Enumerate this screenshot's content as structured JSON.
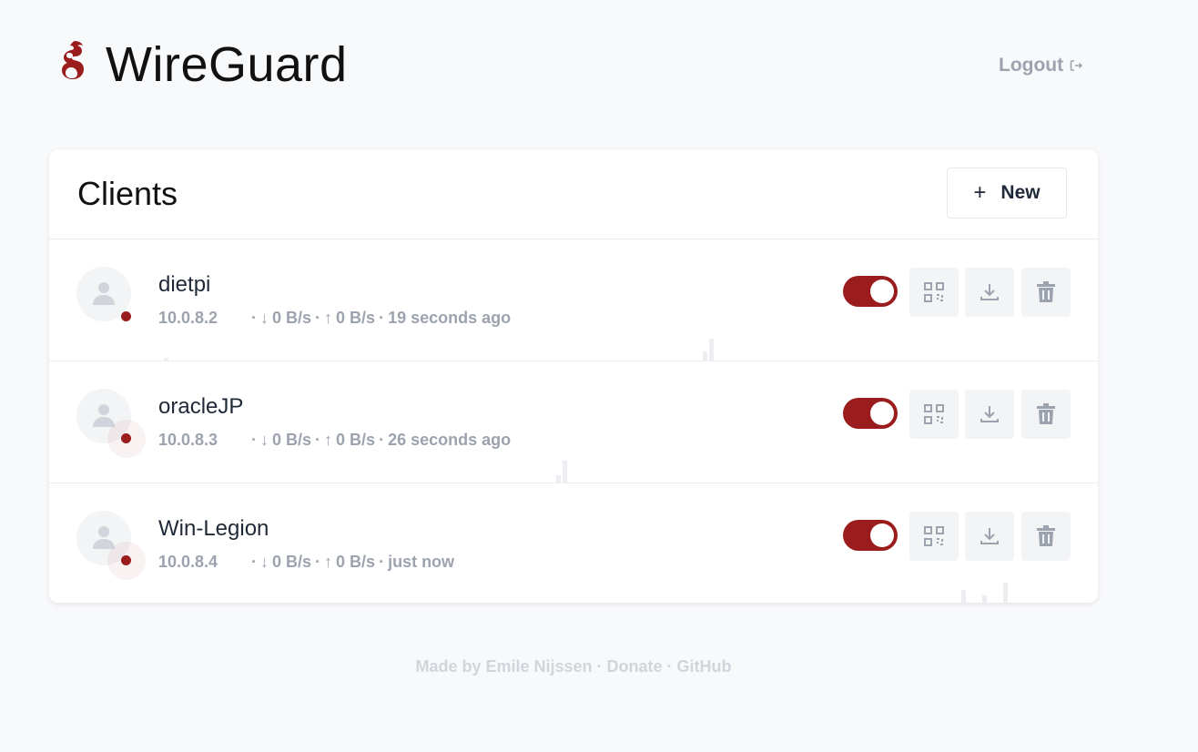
{
  "app": {
    "title": "WireGuard",
    "logout_label": "Logout"
  },
  "clients_card": {
    "title": "Clients",
    "new_button_label": "New"
  },
  "clients": [
    {
      "name": "dietpi",
      "ip": "10.0.8.2",
      "down": "0 B/s",
      "up": "0 B/s",
      "last_seen": "19 seconds ago",
      "enabled": true
    },
    {
      "name": "oracleJP",
      "ip": "10.0.8.3",
      "down": "0 B/s",
      "up": "0 B/s",
      "last_seen": "26 seconds ago",
      "enabled": true
    },
    {
      "name": "Win-Legion",
      "ip": "10.0.8.4",
      "down": "0 B/s",
      "up": "0 B/s",
      "last_seen": "just now",
      "enabled": true
    }
  ],
  "footer": {
    "made_by": "Made by Emile Nijssen",
    "sep": " · ",
    "donate": "Donate",
    "github": "GitHub"
  },
  "colors": {
    "accent": "#9b1c1c",
    "muted": "#9ca3af"
  },
  "icons": {
    "logo": "wireguard-dragon-icon",
    "logout": "logout-icon",
    "new": "plus-icon",
    "avatar": "user-icon",
    "qr": "qr-code-icon",
    "download": "download-icon",
    "delete": "trash-icon"
  }
}
